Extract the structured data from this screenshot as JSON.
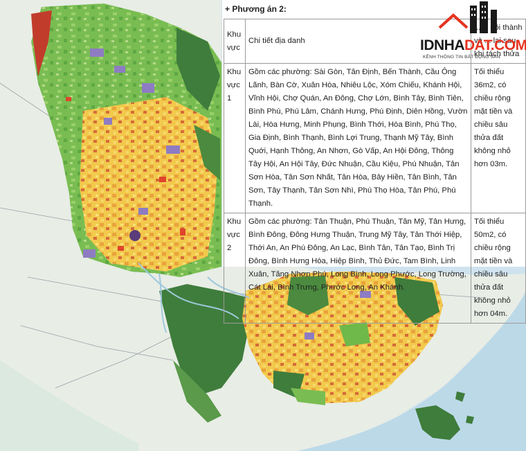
{
  "panel": {
    "title": "+ Phương án 2:",
    "headers": {
      "col1": "Khu vực",
      "col2": "Chi tiết địa danh",
      "col3": "... ở nội thành và ... lại sau khi tách thửa"
    },
    "rows": [
      {
        "zone": "Khu vực 1",
        "details": "Gồm các phường: Sài Gòn, Tân Định, Bến Thành, Cầu Ông Lãnh, Bàn Cờ, Xuân Hòa, Nhiêu Lộc, Xóm Chiếu, Khánh Hội, Vĩnh Hội, Chợ Quán, An Đông, Chợ Lớn, Bình Tây, Bình Tiên, Bình Phú, Phú Lâm, Chánh Hưng, Phú Định, Diên Hồng, Vườn Lài, Hòa Hưng, Minh Phụng, Bình Thới, Hòa Bình, Phú Thọ, Gia Định, Bình Thạnh, Bình Lợi Trung, Thạnh Mỹ Tây, Bình Quới, Hạnh Thông, An Nhơn, Gò Vấp, An Hội Đông, Thông Tây Hội, An Hội Tây, Đức Nhuận, Cầu Kiệu, Phú Nhuận, Tân Sơn Hòa, Tân Sơn Nhất, Tân Hòa, Bảy Hiền, Tân Bình, Tân Sơn, Tây Thạnh, Tân Sơn Nhì, Phú Thọ Hòa, Tân Phú, Phú Thạnh.",
        "requirement": "Tối thiểu 36m2, có chiều rộng mặt tiền và chiều sâu thửa đất không nhỏ hơn 03m."
      },
      {
        "zone": "Khu vực 2",
        "details": "Gồm các phường: Tân Thuận, Phú Thuận, Tân Mỹ, Tân Hưng, Bình Đông, Đông Hưng Thuận, Trung Mỹ Tây, Tân Thới Hiệp, Thới An, An Phú Đông, An Lạc, Bình Tân, Tân Tạo, Bình Trị Đông, Bình Hưng Hòa, Hiệp Bình, Thủ Đức, Tam Bình, Linh Xuân, Tăng Nhơn Phú, Long Bình, Long Phước, Long Trường, Cát Lái, Bình Trưng, Phước Long, An Khánh.",
        "requirement": "Tối thiểu 50m2, có chiều rộng mặt tiền và chiều sâu thửa đất không nhỏ hơn 04m."
      }
    ]
  },
  "logo": {
    "text_dark": "IDNHA",
    "text_red": "DAT.COM",
    "tagline": "KÊNH THÔNG TIN BẤT ĐỘNG SẢN"
  },
  "colors": {
    "sea": "#cfe3ee",
    "land_outside": "#e8ede6",
    "urban": "#f2c94c",
    "green": "#6fb84a",
    "forest": "#3f7d3c",
    "purple": "#8e7cc3",
    "red": "#e0442c",
    "brand_red": "#e5331f"
  }
}
